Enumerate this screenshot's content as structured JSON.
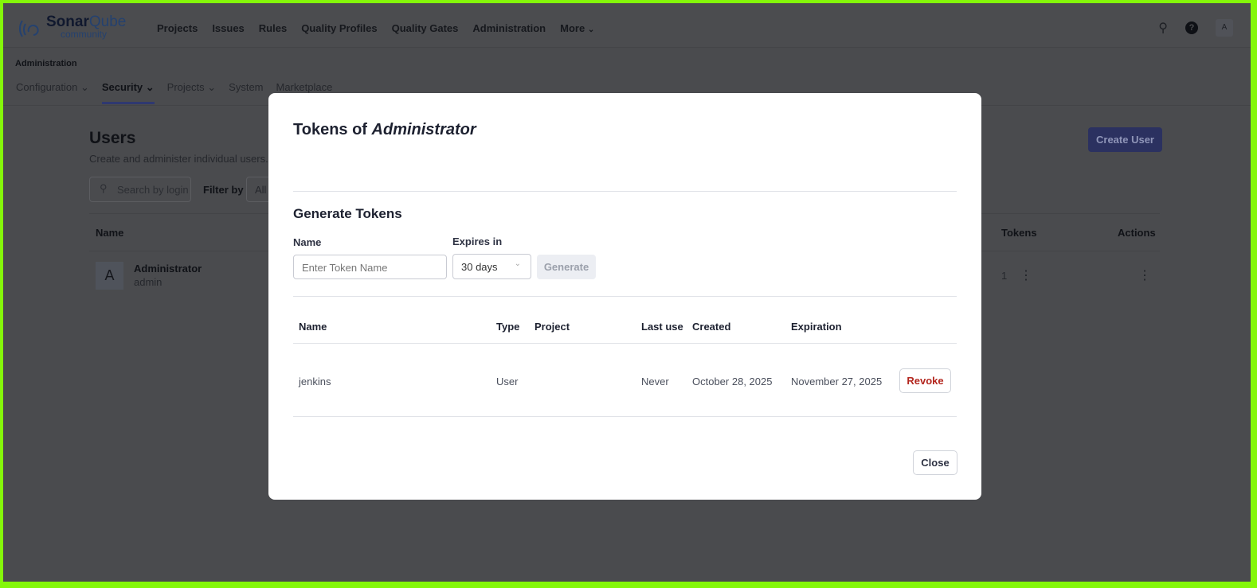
{
  "header": {
    "logo_main": "Sonar",
    "logo_accent": "Qube",
    "logo_sub": "community",
    "nav": [
      "Projects",
      "Issues",
      "Rules",
      "Quality Profiles",
      "Quality Gates",
      "Administration",
      "More"
    ],
    "avatar": "A"
  },
  "admin": {
    "title": "Administration",
    "tabs": [
      "Configuration",
      "Security",
      "Projects",
      "System",
      "Marketplace"
    ]
  },
  "users": {
    "title": "Users",
    "description": "Create and administer individual users.",
    "search_placeholder": "Search by login or name",
    "filter_label": "Filter by",
    "filter_value": "All",
    "create_button": "Create User",
    "columns": {
      "name": "Name",
      "tokens": "Tokens",
      "actions": "Actions"
    },
    "rows": [
      {
        "avatar": "A",
        "name": "Administrator",
        "login": "admin",
        "tokens": "1"
      }
    ]
  },
  "modal": {
    "title_prefix": "Tokens of ",
    "title_user": "Administrator",
    "generate_heading": "Generate Tokens",
    "name_label": "Name",
    "name_placeholder": "Enter Token Name",
    "expires_label": "Expires in",
    "expires_value": "30 days",
    "generate_button": "Generate",
    "columns": [
      "Name",
      "Type",
      "Project",
      "Last use",
      "Created",
      "Expiration"
    ],
    "tokens": [
      {
        "name": "jenkins",
        "type": "User",
        "project": "",
        "last_use": "Never",
        "created": "October 28, 2025",
        "expiration": "November 27, 2025",
        "action": "Revoke"
      }
    ],
    "close_button": "Close"
  },
  "colors": {
    "accent": "#5d6cd0",
    "revoke": "#b3261e",
    "frame": "#84f70a"
  }
}
